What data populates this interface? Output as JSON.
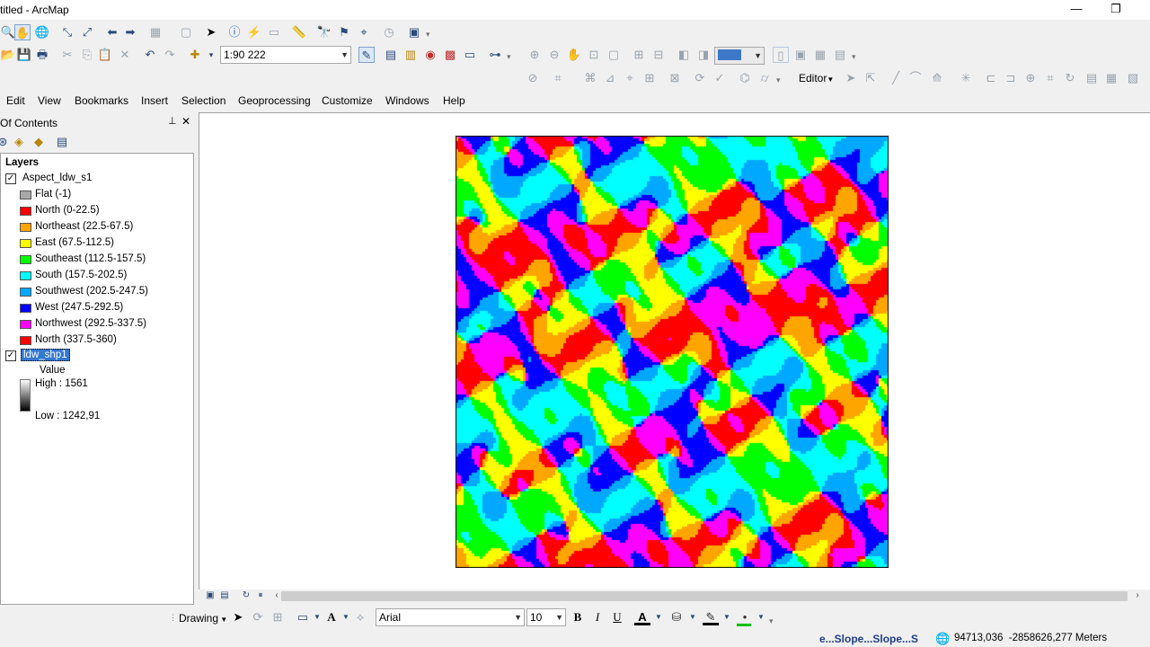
{
  "window": {
    "title": "titled - ArcMap",
    "minimize": "—",
    "restore": "❐"
  },
  "scale": {
    "value": "1:90 222"
  },
  "editor": {
    "label": "Editor"
  },
  "menu": [
    "Edit",
    "View",
    "Bookmarks",
    "Insert",
    "Selection",
    "Geoprocessing",
    "Customize",
    "Windows",
    "Help"
  ],
  "toc": {
    "title": "Of Contents",
    "pin": "ꟷ",
    "close": "✕",
    "root": "Layers",
    "aspect_layer": "Aspect_ldw_s1",
    "aspect_classes": [
      {
        "label": "Flat (-1)",
        "color": "#a8a8a8"
      },
      {
        "label": "North (0-22.5)",
        "color": "#ff0000"
      },
      {
        "label": "Northeast (22.5-67.5)",
        "color": "#ffa500"
      },
      {
        "label": "East (67.5-112.5)",
        "color": "#ffff00"
      },
      {
        "label": "Southeast (112.5-157.5)",
        "color": "#00ff00"
      },
      {
        "label": "South (157.5-202.5)",
        "color": "#00ffff"
      },
      {
        "label": "Southwest (202.5-247.5)",
        "color": "#00a9ff"
      },
      {
        "label": "West (247.5-292.5)",
        "color": "#0000ff"
      },
      {
        "label": "Northwest (292.5-337.5)",
        "color": "#ff00ff"
      },
      {
        "label": "North (337.5-360)",
        "color": "#ff0000"
      }
    ],
    "idw_layer": "ldw_shp1",
    "idw_value_label": "Value",
    "idw_high": "High : 1561",
    "idw_low": "Low : 1242,91"
  },
  "drawing": {
    "label": "Drawing",
    "font_name": "Arial",
    "font_size": "10",
    "bold": "B",
    "italic": "I",
    "underline": "U",
    "font_color_glyph": "A"
  },
  "status": {
    "task": "e...Slope...Slope...S",
    "coordinates": "94713,036  -2858626,277 Meters"
  }
}
